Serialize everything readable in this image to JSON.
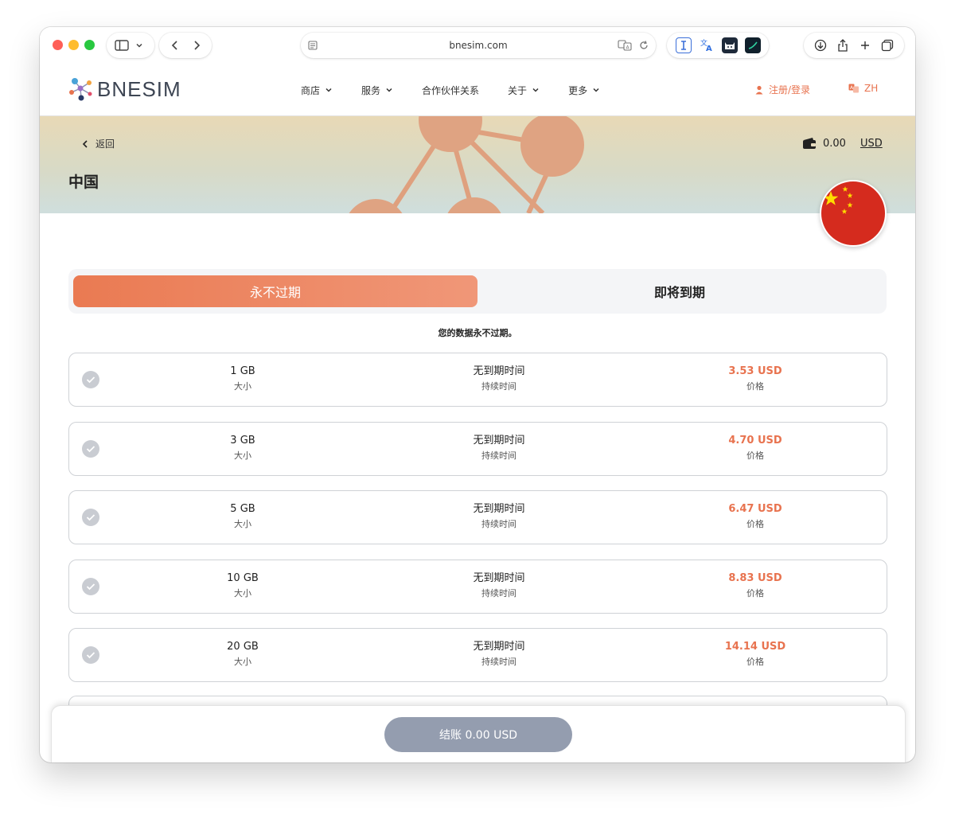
{
  "browser": {
    "url": "bnesim.com"
  },
  "site": {
    "logo_text": "BNESIM",
    "nav": [
      {
        "label": "商店",
        "has_dropdown": true
      },
      {
        "label": "服务",
        "has_dropdown": true
      },
      {
        "label": "合作伙伴关系",
        "has_dropdown": false
      },
      {
        "label": "关于",
        "has_dropdown": true
      },
      {
        "label": "更多",
        "has_dropdown": true
      }
    ],
    "login_label": "注册/登录",
    "language_label": "ZH",
    "accent_color": "#e8734f"
  },
  "hero": {
    "back_label": "返回",
    "title": "中国",
    "wallet_amount": "0.00",
    "wallet_currency": "USD",
    "flag": "china-flag"
  },
  "tabs": {
    "active_label": "永不过期",
    "inactive_label": "即将到期"
  },
  "subtitle": "您的数据永不过期。",
  "plans": [
    {
      "size": "1 GB",
      "size_label": "大小",
      "duration": "无到期时间",
      "duration_label": "持续时间",
      "price": "3.53 USD",
      "price_label": "价格"
    },
    {
      "size": "3 GB",
      "size_label": "大小",
      "duration": "无到期时间",
      "duration_label": "持续时间",
      "price": "4.70 USD",
      "price_label": "价格"
    },
    {
      "size": "5 GB",
      "size_label": "大小",
      "duration": "无到期时间",
      "duration_label": "持续时间",
      "price": "6.47 USD",
      "price_label": "价格"
    },
    {
      "size": "10 GB",
      "size_label": "大小",
      "duration": "无到期时间",
      "duration_label": "持续时间",
      "price": "8.83 USD",
      "price_label": "价格"
    },
    {
      "size": "20 GB",
      "size_label": "大小",
      "duration": "无到期时间",
      "duration_label": "持续时间",
      "price": "14.14 USD",
      "price_label": "价格"
    }
  ],
  "checkout": {
    "label": "结账 0.00 USD",
    "button_color": "#949daf"
  }
}
